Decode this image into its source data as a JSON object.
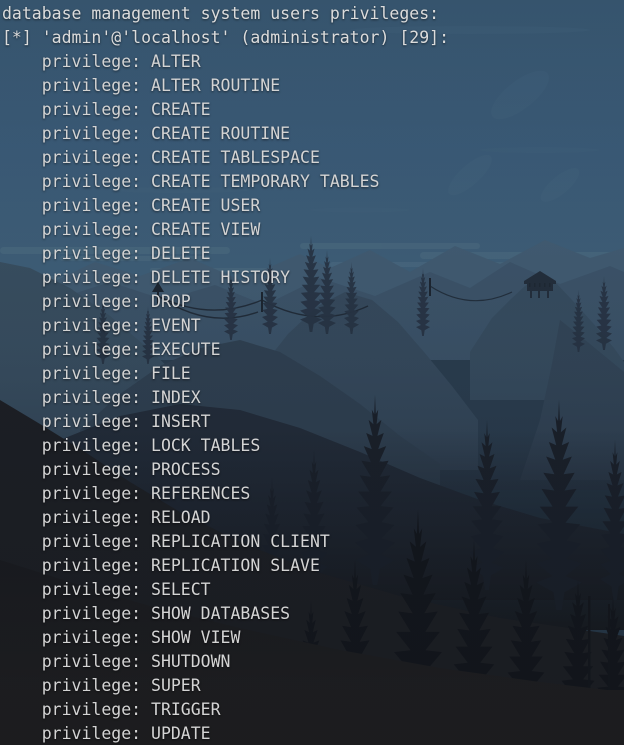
{
  "window": {
    "type": "terminal-emulator",
    "title": "database management system users privileges",
    "transparent_background": true,
    "text_color": "#d4d4d4",
    "font": "monospace",
    "font_size_px": 16.5,
    "line_height_px": 24,
    "indent_spaces": 4
  },
  "wallpaper": {
    "description": "stylized night mountain landscape with layered ridges, a fire-lookout tower on a peak, and coniferous forest silhouettes in the foreground",
    "colors": {
      "sky_top": "#3d5f7a",
      "sky_mid": "#3e5e78",
      "cloud": "#4a6b84",
      "ridge_far": "#46637c",
      "ridge_mid": "#3f5670",
      "ridge_near": "#364a61",
      "ridge_dark": "#2d3c50",
      "tree_far": "#2b3a4c",
      "tree_mid": "#1f2835",
      "tree_near": "#151a22",
      "foreground": "#1d1e20",
      "bottom": "#202022"
    }
  },
  "output": {
    "header_line": "database management system users privileges:",
    "user_line": "[*] 'admin'@'localhost' (administrator) [29]:",
    "user": {
      "marker": "[*]",
      "name": "admin",
      "host": "localhost",
      "role": "administrator",
      "privilege_count": 29
    },
    "privilege_label": "privilege:",
    "privileges": [
      "ALTER",
      "ALTER ROUTINE",
      "CREATE",
      "CREATE ROUTINE",
      "CREATE TABLESPACE",
      "CREATE TEMPORARY TABLES",
      "CREATE USER",
      "CREATE VIEW",
      "DELETE",
      "DELETE HISTORY",
      "DROP",
      "EVENT",
      "EXECUTE",
      "FILE",
      "INDEX",
      "INSERT",
      "LOCK TABLES",
      "PROCESS",
      "REFERENCES",
      "RELOAD",
      "REPLICATION CLIENT",
      "REPLICATION SLAVE",
      "SELECT",
      "SHOW DATABASES",
      "SHOW VIEW",
      "SHUTDOWN",
      "SUPER",
      "TRIGGER",
      "UPDATE"
    ]
  }
}
